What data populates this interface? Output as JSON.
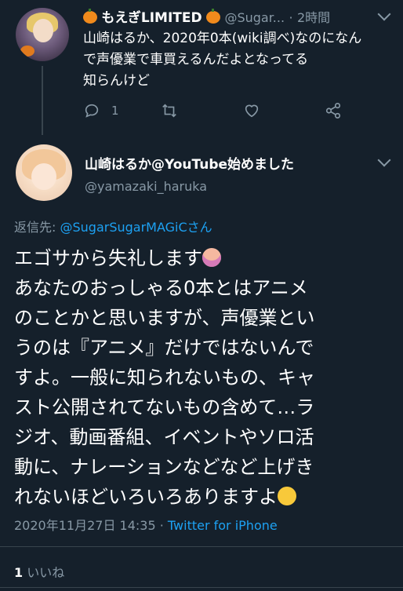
{
  "reply_parent": {
    "display_name": "もえぎLIMITED",
    "handle": "@Sugar...",
    "separator": "·",
    "time": "2時間",
    "text_lines": [
      "山崎はるか、2020年0本(wiki調べ)なのになん",
      "で声優業で車買えるんだよとなってる",
      "知らんけど"
    ],
    "reply_count": "1",
    "icons": [
      "pumpkin-emoji",
      "reply-icon",
      "retweet-icon",
      "like-icon",
      "share-icon",
      "chevron-down-icon"
    ]
  },
  "tweet": {
    "display_name": "山崎はるか@YouTube始めました",
    "handle": "@yamazaki_haruka",
    "reply_label": "返信先: ",
    "reply_target": "@SugarSugarMAGiCさん",
    "body_lines": [
      "エゴサから失礼します",
      "あなたのおっしゃる0本とはアニメ",
      "のことかと思いますが、声優業とい",
      "うのは『アニメ』だけではないんで",
      "すよ。一般に知られないもの、キャ",
      "スト公開されてないもの含めて…ラ",
      "ジオ、動画番組、イベントやソロ活",
      "動に、ナレーションなどなど上げき",
      "れないほどいろいろありますよ"
    ],
    "timestamp": "2020年11月27日 14:35",
    "meta_separator": " · ",
    "source": "Twitter for iPhone",
    "like_count": "1",
    "like_label": " いいね"
  },
  "colors": {
    "background": "#15202b",
    "text": "#ffffff",
    "muted": "#8899a6",
    "accent": "#1da1f2",
    "divider": "#38444d"
  }
}
